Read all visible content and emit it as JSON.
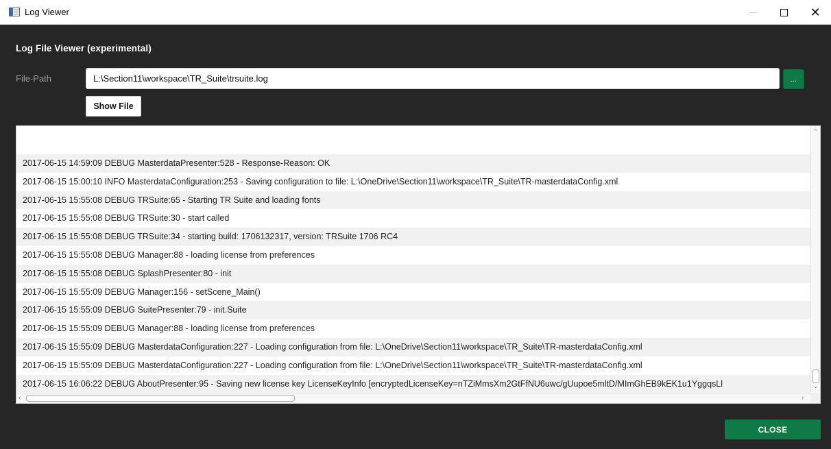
{
  "window": {
    "title": "Log Viewer",
    "minimize_icon": "minimize-icon",
    "maximize_icon": "maximize-icon",
    "close_glyph": "✕"
  },
  "header": {
    "title": "Log File Viewer (experimental)"
  },
  "file": {
    "label": "File-Path",
    "value": "L:\\Section11\\workspace\\TR_Suite\\trsuite.log",
    "browse_label": "...",
    "show_label": "Show File"
  },
  "log": {
    "lines": [
      "2017-06-15 14:59:09 DEBUG MasterdataPresenter:528 - Response-Reason: OK",
      "2017-06-15 15:00:10 INFO  MasterdataConfiguration:253 - Saving configuration to file: L:\\OneDrive\\Section11\\workspace\\TR_Suite\\TR-masterdataConfig.xml",
      "2017-06-15 15:55:08 DEBUG TRSuite:65 - Starting TR Suite and loading fonts",
      "2017-06-15 15:55:08 DEBUG TRSuite:30 - start called",
      "2017-06-15 15:55:08 DEBUG TRSuite:34 - starting build: 1706132317, version: TRSuite 1706 RC4",
      "2017-06-15 15:55:08 DEBUG Manager:88 - loading license from preferences",
      "2017-06-15 15:55:08 DEBUG SplashPresenter:80 - init",
      "2017-06-15 15:55:09 DEBUG Manager:156 - setScene_Main()",
      "2017-06-15 15:55:09 DEBUG SuitePresenter:79 - init.Suite",
      "2017-06-15 15:55:09 DEBUG Manager:88 - loading license from preferences",
      "2017-06-15 15:55:09 DEBUG MasterdataConfiguration:227 - Loading configuration from file: L:\\OneDrive\\Section11\\workspace\\TR_Suite\\TR-masterdataConfig.xml",
      "2017-06-15 15:55:09 DEBUG MasterdataConfiguration:227 - Loading configuration from file: L:\\OneDrive\\Section11\\workspace\\TR_Suite\\TR-masterdataConfig.xml",
      "2017-06-15 16:06:22 DEBUG AboutPresenter:95 - Saving new license key LicenseKeyInfo [encryptedLicenseKey=nTZiMmsXm2GtFfNU6uwc/gUupoe5mltD/MImGhEB9kEK1u1YggqsLl"
    ]
  },
  "footer": {
    "close_label": "CLOSE"
  },
  "colors": {
    "accent": "#0e7a46",
    "background": "#262626"
  }
}
